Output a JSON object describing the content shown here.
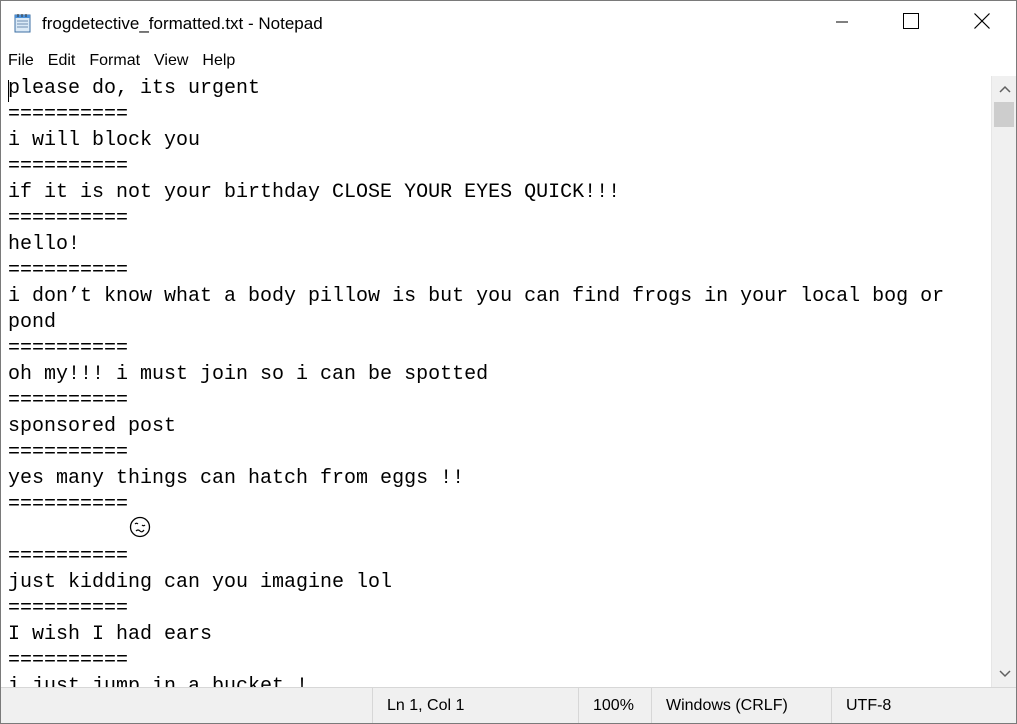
{
  "window": {
    "title": "frogdetective_formatted.txt - Notepad"
  },
  "menu": {
    "items": [
      "File",
      "Edit",
      "Format",
      "View",
      "Help"
    ]
  },
  "editor": {
    "lines": [
      "please do, its urgent",
      "==========",
      "i will block you",
      "==========",
      "if it is not your birthday CLOSE YOUR EYES QUICK!!!",
      "==========",
      "hello!",
      "==========",
      "i don’t know what a body pillow is but you can find frogs in your local bog or",
      "pond",
      "==========",
      "oh my!!! i must join so i can be spotted",
      "==========",
      "sponsored post",
      "==========",
      "yes many things can hatch from eggs !!",
      "==========",
      "🥴",
      "==========",
      "just kidding can you imagine lol",
      "==========",
      "I wish I had ears",
      "==========",
      "i just jump in a bucket !"
    ]
  },
  "statusbar": {
    "position": "Ln 1, Col 1",
    "zoom": "100%",
    "line_ending": "Windows (CRLF)",
    "encoding": "UTF-8"
  },
  "icons": {
    "app": "notepad-icon",
    "minimize": "minimize-icon",
    "maximize": "maximize-icon",
    "close": "close-icon",
    "scroll_up": "chevron-up-icon",
    "scroll_down": "chevron-down-icon"
  }
}
